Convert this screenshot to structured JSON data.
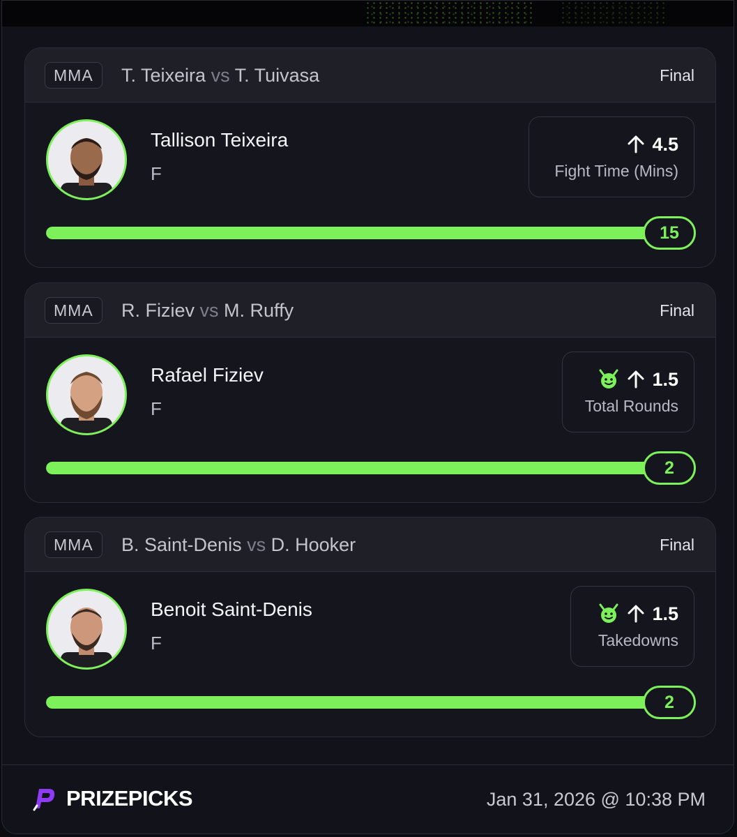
{
  "accent_color": "#7cf15a",
  "cards": [
    {
      "league": "MMA",
      "player_a": "T. Teixeira",
      "vs": "vs",
      "player_b": "T. Tuivasa",
      "status": "Final",
      "player_name": "Tallison Teixeira",
      "position": "F",
      "direction_icon": "arrow-up-icon",
      "line": "4.5",
      "stat": "Fight Time (Mins)",
      "demon_icon": false,
      "result": "15",
      "progress_fraction": 1.0
    },
    {
      "league": "MMA",
      "player_a": "R. Fiziev",
      "vs": "vs",
      "player_b": "M. Ruffy",
      "status": "Final",
      "player_name": "Rafael Fiziev",
      "position": "F",
      "direction_icon": "arrow-up-icon",
      "line": "1.5",
      "stat": "Total Rounds",
      "demon_icon": true,
      "result": "2",
      "progress_fraction": 1.0
    },
    {
      "league": "MMA",
      "player_a": "B. Saint-Denis",
      "vs": "vs",
      "player_b": "D. Hooker",
      "status": "Final",
      "player_name": "Benoit Saint-Denis",
      "position": "F",
      "direction_icon": "arrow-up-icon",
      "line": "1.5",
      "stat": "Takedowns",
      "demon_icon": true,
      "result": "2",
      "progress_fraction": 1.0
    }
  ],
  "footer": {
    "brand": "PRIZEPICKS",
    "logo_icon": "prizepicks-logo-icon",
    "timestamp": "Jan 31, 2026 @ 10:38 PM"
  }
}
